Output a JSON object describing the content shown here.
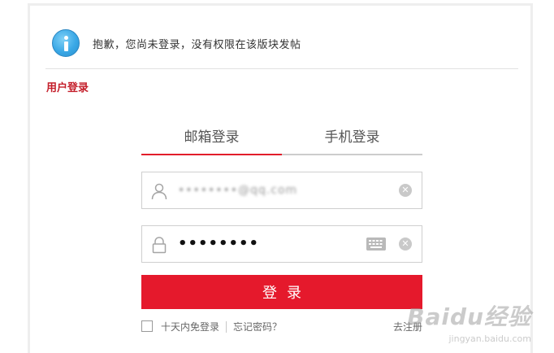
{
  "notice": {
    "icon": "info-icon",
    "text": "抱歉，您尚未登录，没有权限在该版块发帖"
  },
  "section": {
    "title": "用户登录"
  },
  "tabs": [
    {
      "label": "邮箱登录",
      "active": true
    },
    {
      "label": "手机登录",
      "active": false
    }
  ],
  "form": {
    "username": {
      "icon": "user-icon",
      "value": "••••••••@qq.com",
      "clear_icon": "clear-icon",
      "clear_glyph": "✕"
    },
    "password": {
      "icon": "lock-icon",
      "value": "••••••••",
      "keyboard_icon": "keyboard-icon",
      "clear_icon": "clear-icon",
      "clear_glyph": "✕"
    },
    "submit_label": "登录",
    "remember_label": "十天内免登录",
    "forgot_label": "忘记密码？",
    "register_label": "去注册"
  },
  "watermark": {
    "main": "Baidu经验",
    "sub": "jingyan.baidu.com"
  },
  "colors": {
    "accent": "#e5192c",
    "section_title": "#c41e2a",
    "info_blue": "#3aa8e6"
  }
}
